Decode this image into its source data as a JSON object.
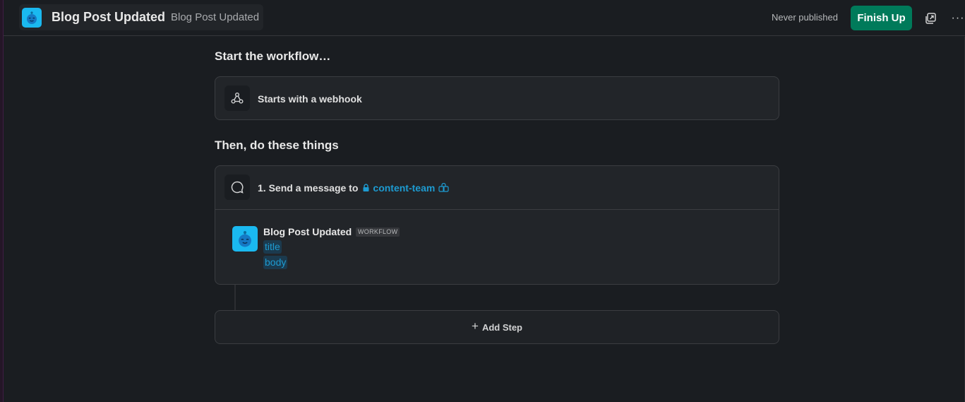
{
  "header": {
    "title": "Blog Post Updated",
    "subtitle": "Blog Post Updated",
    "status": "Never published",
    "finish_label": "Finish Up",
    "popout_icon": "popout-icon",
    "more_icon": "more-icon",
    "more_glyph": "···"
  },
  "colors": {
    "accent_green": "#007a5a",
    "link_blue": "#1d9bd1",
    "bot_blue": "#1ab9f0"
  },
  "trigger": {
    "heading": "Start the workflow…",
    "label": "Starts with a webhook",
    "icon": "webhook-icon"
  },
  "steps": {
    "heading": "Then, do these things",
    "items": [
      {
        "prefix": "1. Send a message to",
        "channel": "content-team",
        "icon": "message-bubble-icon",
        "preview": {
          "sender": "Blog Post Updated",
          "badge": "WORKFLOW",
          "variables": [
            "title",
            "body"
          ]
        }
      }
    ]
  },
  "add_step": {
    "label": "Add Step",
    "plus": "+"
  }
}
